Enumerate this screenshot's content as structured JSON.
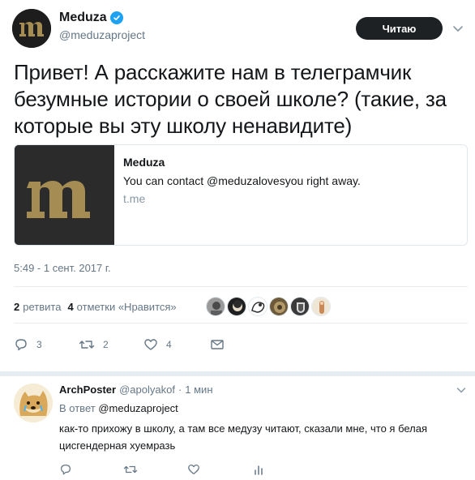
{
  "tweet": {
    "author_name": "Meduza",
    "author_handle": "@meduzaproject",
    "follow_label": "Читаю",
    "text": "Привет! А расскажите нам в телеграмчик безумные истории о своей школе? (такие, за которые вы эту школу ненавидите)",
    "card": {
      "title": "Meduza",
      "description": "You can contact @meduzalovesyou right away.",
      "domain": "t.me"
    },
    "timestamp": "5:49 - 1 сент. 2017 г.",
    "retweets_count": "2",
    "retweets_label": "ретвита",
    "likes_count": "4",
    "likes_label": "отметки «Нравится»",
    "actions": {
      "reply_count": "3",
      "retweet_count": "2",
      "like_count": "4"
    },
    "likers": [
      {
        "color": "#6b6b6b"
      },
      {
        "color": "#2a2a2a"
      },
      {
        "color": "#c9c9c9"
      },
      {
        "color": "#8a7a56"
      },
      {
        "color": "#5a5a5a"
      },
      {
        "color": "#d9c3a0"
      }
    ]
  },
  "reply": {
    "author_name": "ArchPoster",
    "author_handle": "@apolyakof",
    "separator": "·",
    "time": "1 мин",
    "reply_to_prefix": "В ответ",
    "reply_to_handle": "@meduzaproject",
    "text": "как-то прихожу в школу, а там все медузу читают, сказали мне, что я белая цисгендерная хуемразь"
  },
  "colors": {
    "accent": "#1da1f2",
    "secondary_text": "#657786",
    "border": "#e1e8ed"
  }
}
